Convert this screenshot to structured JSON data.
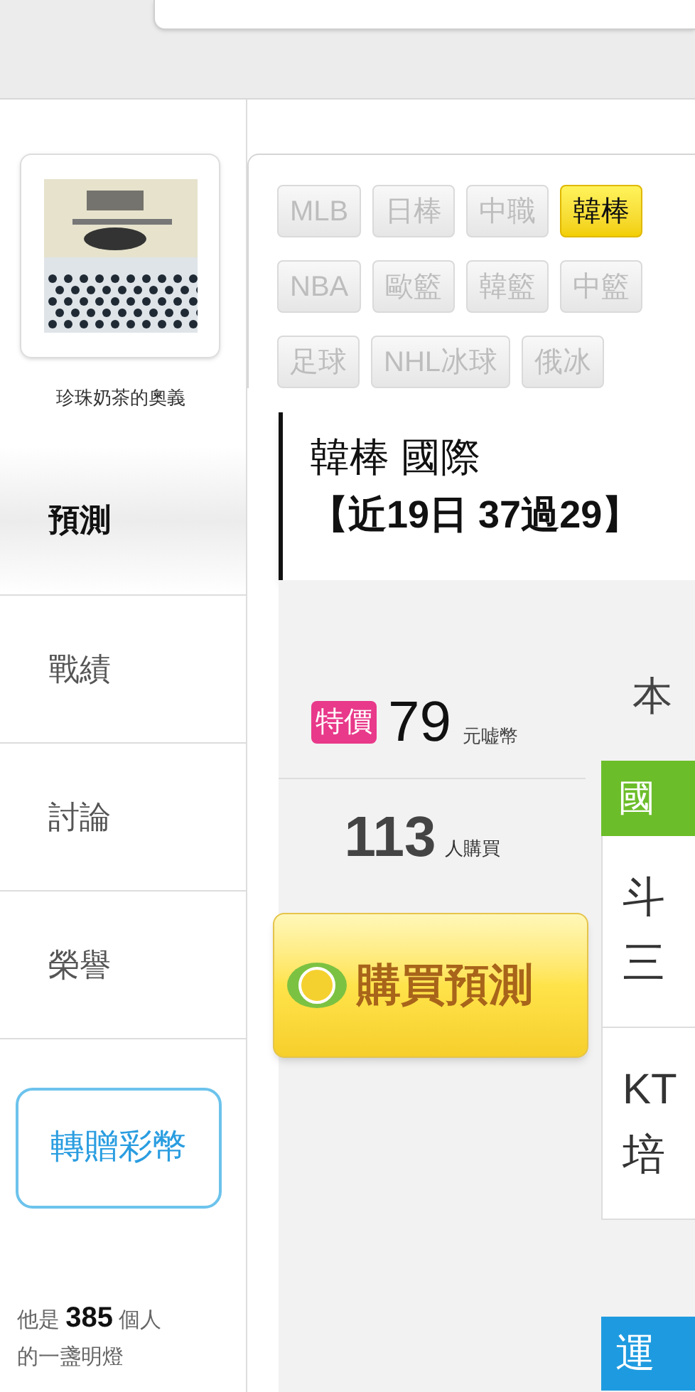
{
  "profile": {
    "name": "珍珠奶茶的奧義"
  },
  "nav": [
    {
      "label": "預測",
      "selected": true
    },
    {
      "label": "戰績",
      "selected": false
    },
    {
      "label": "討論",
      "selected": false
    },
    {
      "label": "榮譽",
      "selected": false
    }
  ],
  "gift_button": "轉贈彩幣",
  "lamp": {
    "prefix": "他是",
    "count": "385",
    "suffix": "個人",
    "line2": "的一盞明燈"
  },
  "tag_rows": [
    [
      {
        "label": "MLB",
        "selected": false
      },
      {
        "label": "日棒",
        "selected": false
      },
      {
        "label": "中職",
        "selected": false
      },
      {
        "label": "韓棒",
        "selected": true
      }
    ],
    [
      {
        "label": "NBA",
        "selected": false
      },
      {
        "label": "歐籃",
        "selected": false
      },
      {
        "label": "韓籃",
        "selected": false
      },
      {
        "label": "中籃",
        "selected": false
      }
    ],
    [
      {
        "label": "足球",
        "selected": false
      },
      {
        "label": "NHL冰球",
        "selected": false
      },
      {
        "label": "俄冰",
        "selected": false
      }
    ]
  ],
  "title": {
    "line1": "韓棒 國際",
    "line2": "【近19日 37過29】"
  },
  "price": {
    "badge": "特價",
    "amount": "79",
    "unit": "元嘘幣"
  },
  "buyers": {
    "count": "113",
    "unit": "人購買"
  },
  "buy_button": "購買預測",
  "right_column": {
    "heading": "本",
    "league": "國",
    "matches": [
      [
        "斗",
        "三"
      ],
      [
        "KT",
        "培"
      ]
    ],
    "footer": "運"
  }
}
